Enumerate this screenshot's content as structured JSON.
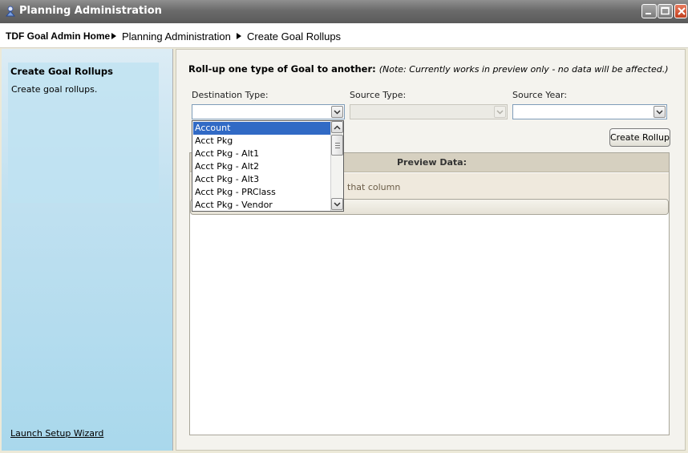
{
  "window": {
    "title": "Planning Administration"
  },
  "breadcrumb": {
    "home": "TDF Goal Admin Home",
    "items": [
      "Planning Administration",
      "Create Goal Rollups"
    ]
  },
  "sidebar": {
    "title": "Create Goal Rollups",
    "description": "Create goal rollups.",
    "wizard_link": "Launch Setup Wizard"
  },
  "main": {
    "heading": "Roll-up one type of Goal to another:",
    "note": "(Note: Currently works in preview only - no data will be affected.)",
    "fields": {
      "destination": {
        "label": "Destination Type:",
        "value": ""
      },
      "source": {
        "label": "Source Type:",
        "value": ""
      },
      "year": {
        "label": "Source Year:",
        "value": ""
      }
    },
    "create_button": "Create Rollup",
    "preview": {
      "title": "Preview Data:",
      "hint": "that column"
    }
  },
  "dropdown": {
    "selected": "Account",
    "items": [
      "Account",
      "Acct Pkg",
      "Acct Pkg - Alt1",
      "Acct Pkg - Alt2",
      "Acct Pkg - Alt3",
      "Acct Pkg - PRClass",
      "Acct Pkg - Vendor"
    ]
  }
}
